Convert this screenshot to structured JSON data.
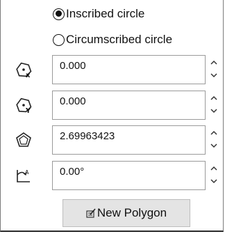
{
  "options": {
    "inscribed_label": "Inscribed circle",
    "circumscribed_label": "Circumscribed circle",
    "selected": "inscribed"
  },
  "fields": [
    {
      "icon": "center-x-icon",
      "value": "0.000"
    },
    {
      "icon": "center-y-icon",
      "value": "0.000"
    },
    {
      "icon": "polygon-diameter-icon",
      "value": "2.69963423"
    },
    {
      "icon": "rotation-angle-icon",
      "value": "0.00°"
    }
  ],
  "button": {
    "label": "New Polygon",
    "icon": "new-polygon-icon"
  }
}
